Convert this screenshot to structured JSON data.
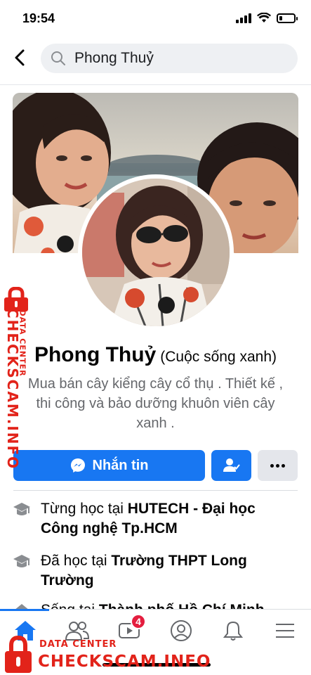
{
  "status_bar": {
    "time": "19:54",
    "battery_level": 0.2
  },
  "search": {
    "query": "Phong Thuỷ"
  },
  "profile": {
    "name": "Phong Thuỷ",
    "alternate_name": "(Cuộc sống xanh)",
    "bio": "Mua bán cây kiểng cây cổ thụ . Thiết kế , thi công và bảo dưỡng khuôn viên cây xanh ."
  },
  "actions": {
    "message_label": "Nhắn tin",
    "message_icon": "messenger-icon",
    "friend_icon": "add-friend-icon",
    "more_icon": "more-icon"
  },
  "info": [
    {
      "icon": "education-icon",
      "prefix": "Từng học tại ",
      "place": "HUTECH - Đại học Công nghệ Tp.HCM"
    },
    {
      "icon": "education-icon",
      "prefix": "Đã học tại ",
      "place": "Trường THPT Long Trường"
    },
    {
      "icon": "home-icon",
      "prefix": "Sống tại ",
      "place": "Thành phố Hồ Chí Minh"
    }
  ],
  "bottom_nav": {
    "items": [
      "home",
      "friends",
      "watch",
      "profile",
      "notifications",
      "menu"
    ],
    "watch_badge": "4",
    "accent_color": "#1877f2"
  },
  "watermark": {
    "title": "CHECKSCAM.INFO",
    "subtitle": "DATA CENTER",
    "color": "#e2231a"
  }
}
